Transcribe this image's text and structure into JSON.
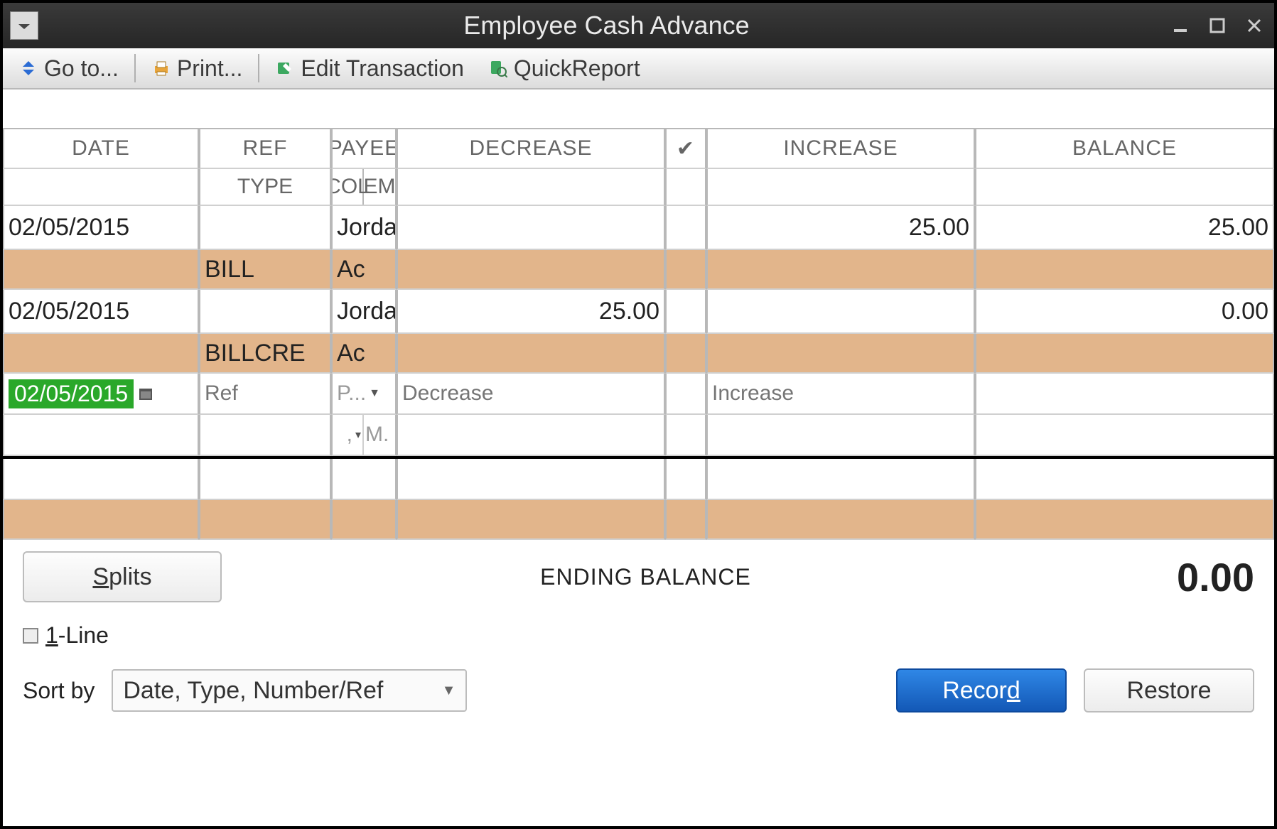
{
  "window": {
    "title": "Employee Cash Advance"
  },
  "toolbar": {
    "goto_label": "Go to...",
    "print_label": "Print...",
    "edit_label": "Edit Transaction",
    "quickreport_label": "QuickReport"
  },
  "headers": {
    "date": "DATE",
    "ref": "REF",
    "payee": "PAYEE",
    "decrease": "DECREASE",
    "check": "✔",
    "increase": "INCREASE",
    "balance": "BALANCE",
    "type": "TYPE",
    "col": "COL",
    "em": "EM"
  },
  "rows": [
    {
      "date": "02/05/2015",
      "ref": "",
      "payee": "Jordan",
      "decrease": "",
      "check": "",
      "increase": "25.00",
      "balance": "25.00",
      "type": "BILL",
      "col": "Ac",
      "em": ""
    },
    {
      "date": "02/05/2015",
      "ref": "",
      "payee": "Jordan",
      "decrease": "25.00",
      "check": "",
      "increase": "",
      "balance": "0.00",
      "type": "BILLCRE",
      "col": "Ac",
      "em": ""
    }
  ],
  "entry": {
    "date": "02/05/2015",
    "ref_placeholder": "Ref",
    "payee_placeholder": "P...",
    "decrease_placeholder": "Decrease",
    "increase_placeholder": "Increase",
    "col_placeholder": ",",
    "em_placeholder": "M."
  },
  "footer": {
    "splits_label": "Splits",
    "ending_label": "ENDING BALANCE",
    "ending_value": "0.00",
    "oneline_label": "1-Line",
    "sortby_label": "Sort by",
    "sort_selected": "Date, Type, Number/Ref",
    "record_label": "Record",
    "restore_label": "Restore"
  }
}
